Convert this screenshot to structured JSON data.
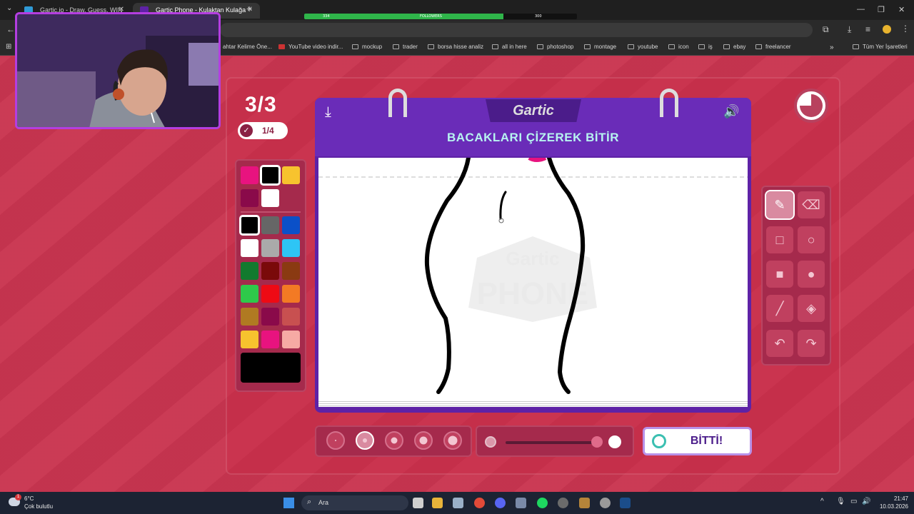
{
  "browser": {
    "tabs": [
      {
        "label": "Gartic.io - Draw, Guess, WIN",
        "active": false,
        "favicon_color": "#2f9ad6"
      },
      {
        "label": "Gartic Phone - Kulaktan Kulağa",
        "active": true,
        "favicon_color": "#5e22a6"
      }
    ],
    "overlay": {
      "left": "334",
      "center": "FOLLOWERS",
      "right": "300",
      "fill_fraction": 0.73,
      "accent": "#2fb54a"
    },
    "bookmarks": [
      "ahtar Kelime Öne...",
      "YouTube video indir...",
      "mockup",
      "trader",
      "borsa hisse analiz",
      "all in here",
      "photoshop",
      "montage",
      "youtube",
      "icon",
      "iş",
      "ebay",
      "freelancer"
    ],
    "bookmarks_more": "Tüm Yer İşaretleri"
  },
  "game": {
    "round": "3/3",
    "progress": "1/4",
    "task": "BACAKLARI ÇİZEREK BİTİR",
    "logo": "Gartic",
    "watermark_top": "Gartic",
    "watermark_bottom": "PHONE",
    "done_label": "BİTTİ!",
    "timer_elapsed_fraction": 0.75,
    "selected_color": "#000000",
    "colors_top": [
      "#e8137f",
      "#000000",
      "#f7c32e",
      "#8a0a4a",
      "#ffffff"
    ],
    "colors_main": [
      "#000000",
      "#666666",
      "#0b50c8",
      "#ffffff",
      "#aaaaaa",
      "#2ec5f5",
      "#127a2e",
      "#7a0a0a",
      "#8a3a12",
      "#2ec94a",
      "#ee0a14",
      "#f37a24",
      "#b07a22",
      "#8a0a4a",
      "#c85050",
      "#f7c32e",
      "#e8137f",
      "#f6aaa4"
    ],
    "selected_tool": "pencil",
    "selected_size_index": 1,
    "opacity": 1.0
  },
  "taskbar": {
    "temperature": "6°C",
    "weather": "Çok bulutlu",
    "weather_badge": "1",
    "search": "Ara",
    "time": "21:47",
    "date": "10.03.2026"
  },
  "colors": {
    "accent": "#5e22a6",
    "bg": "#c93550",
    "panel": "#a52a4c"
  }
}
